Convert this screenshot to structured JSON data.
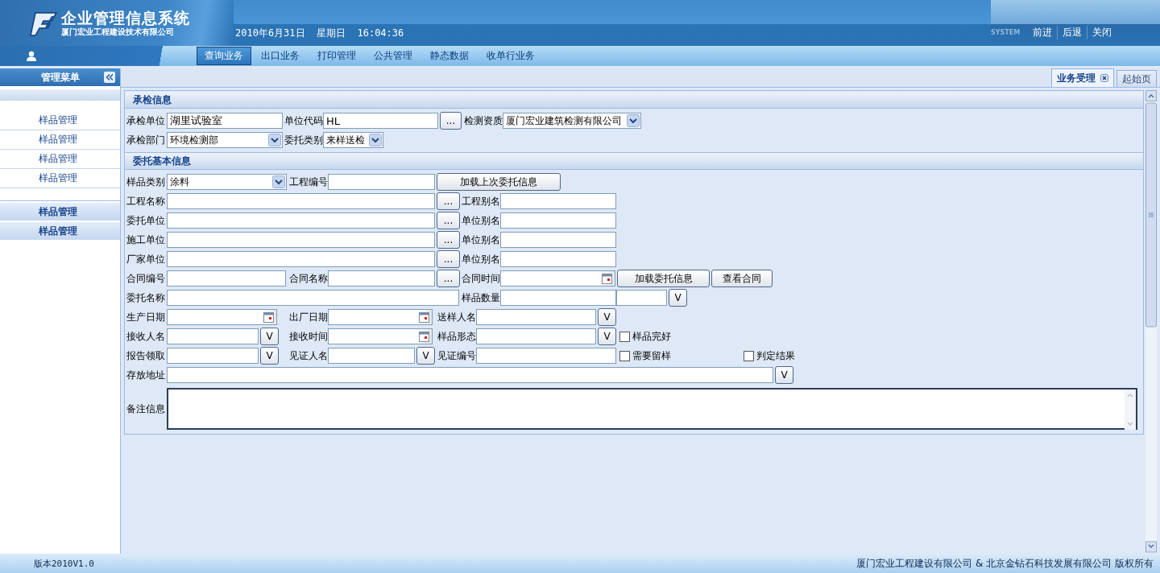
{
  "header": {
    "title": "企业管理信息系统",
    "company": "厦门宏业工程建设技术有限公司",
    "datetime": "2010年6月31日  星期日  16:04:36",
    "banner_text": "SYSTEM",
    "links": [
      "前进",
      "后退",
      "关闭"
    ]
  },
  "nav": [
    {
      "label": "查询业务",
      "selected": true
    },
    {
      "label": "出口业务",
      "selected": false
    },
    {
      "label": "打印管理",
      "selected": false
    },
    {
      "label": "公共管理",
      "selected": false
    },
    {
      "label": "静态数据",
      "selected": false
    },
    {
      "label": "收单行业务",
      "selected": false
    }
  ],
  "sidebar": {
    "title": "管理菜单",
    "items": [
      "样品管理",
      "样品管理",
      "样品管理",
      "样品管理"
    ],
    "groups": [
      "样品管理",
      "样品管理"
    ]
  },
  "page_tabs": [
    {
      "label": "业务受理",
      "selected": true,
      "closable": true
    },
    {
      "label": "起始页",
      "selected": false,
      "closable": false
    }
  ],
  "sections": [
    {
      "title": "承检信息",
      "lines": [
        {
          "fields": [
            {
              "kind": "label",
              "text": "承检单位"
            },
            {
              "kind": "text",
              "value": "湖里试验室"
            },
            {
              "kind": "label",
              "text": "单位代码"
            },
            {
              "kind": "text",
              "value": "HL"
            },
            {
              "kind": "button",
              "text": "..."
            },
            {
              "kind": "label",
              "text": "检测资质"
            },
            {
              "kind": "select",
              "value": "厦门宏业建筑检测有限公司"
            }
          ]
        },
        {
          "fields": [
            {
              "kind": "label",
              "text": "承检部门"
            },
            {
              "kind": "select",
              "value": "环境检测部"
            },
            {
              "kind": "label",
              "text": "委托类别"
            },
            {
              "kind": "select",
              "value": "来样送检"
            }
          ]
        }
      ]
    },
    {
      "title": "委托基本信息",
      "lines": [
        {
          "fields": [
            {
              "kind": "label",
              "text": "样品类别"
            },
            {
              "kind": "select",
              "value": "涂料"
            },
            {
              "kind": "label",
              "text": "工程编号"
            },
            {
              "kind": "text"
            },
            {
              "kind": "button",
              "text": "加载上次委托信息"
            }
          ]
        },
        {
          "fields": [
            {
              "kind": "label",
              "text": "工程名称"
            },
            {
              "kind": "text"
            },
            {
              "kind": "button",
              "text": "..."
            },
            {
              "kind": "label",
              "text": "工程别名"
            },
            {
              "kind": "text"
            }
          ]
        },
        {
          "fields": [
            {
              "kind": "label",
              "text": "委托单位"
            },
            {
              "kind": "text"
            },
            {
              "kind": "button",
              "text": "..."
            },
            {
              "kind": "label",
              "text": "单位别名"
            },
            {
              "kind": "text"
            }
          ]
        },
        {
          "fields": [
            {
              "kind": "label",
              "text": "施工单位"
            },
            {
              "kind": "text"
            },
            {
              "kind": "button",
              "text": "..."
            },
            {
              "kind": "label",
              "text": "单位别名"
            },
            {
              "kind": "text"
            }
          ]
        },
        {
          "fields": [
            {
              "kind": "label",
              "text": "厂家单位"
            },
            {
              "kind": "text"
            },
            {
              "kind": "button",
              "text": "..."
            },
            {
              "kind": "label",
              "text": "单位别名"
            },
            {
              "kind": "text"
            }
          ]
        },
        {
          "fields": [
            {
              "kind": "label",
              "text": "合同编号"
            },
            {
              "kind": "text"
            },
            {
              "kind": "label",
              "text": "合同名称"
            },
            {
              "kind": "text"
            },
            {
              "kind": "button",
              "text": "..."
            },
            {
              "kind": "label",
              "text": "合同时间"
            },
            {
              "kind": "date"
            },
            {
              "kind": "button",
              "text": "加载委托信息"
            },
            {
              "kind": "button",
              "text": "查看合同"
            }
          ]
        },
        {
          "fields": [
            {
              "kind": "label",
              "text": "委托名称"
            },
            {
              "kind": "text"
            },
            {
              "kind": "label",
              "text": "样品数量"
            },
            {
              "kind": "text"
            },
            {
              "kind": "text"
            },
            {
              "kind": "button",
              "text": "V"
            }
          ]
        },
        {
          "fields": [
            {
              "kind": "label",
              "text": "生产日期"
            },
            {
              "kind": "date"
            },
            {
              "kind": "label",
              "text": "出厂日期"
            },
            {
              "kind": "date"
            },
            {
              "kind": "label",
              "text": "送样人名"
            },
            {
              "kind": "text"
            },
            {
              "kind": "button",
              "text": "V"
            }
          ]
        },
        {
          "fields": [
            {
              "kind": "label",
              "text": "接收人名"
            },
            {
              "kind": "text"
            },
            {
              "kind": "button",
              "text": "V"
            },
            {
              "kind": "label",
              "text": "接收时间"
            },
            {
              "kind": "date"
            },
            {
              "kind": "label",
              "text": "样品形态"
            },
            {
              "kind": "text"
            },
            {
              "kind": "button",
              "text": "V"
            },
            {
              "kind": "checkbox",
              "text": "样品完好",
              "checked": false
            }
          ]
        },
        {
          "fields": [
            {
              "kind": "label",
              "text": "报告领取"
            },
            {
              "kind": "text"
            },
            {
              "kind": "button",
              "text": "V"
            },
            {
              "kind": "label",
              "text": "见证人名"
            },
            {
              "kind": "text"
            },
            {
              "kind": "button",
              "text": "V"
            },
            {
              "kind": "label",
              "text": "见证编号"
            },
            {
              "kind": "text"
            },
            {
              "kind": "checkbox",
              "text": "需要留样",
              "checked": false
            },
            {
              "kind": "checkbox",
              "text": "判定结果",
              "checked": false
            }
          ]
        },
        {
          "fields": [
            {
              "kind": "label",
              "text": "存放地址"
            },
            {
              "kind": "text"
            },
            {
              "kind": "button",
              "text": "V"
            }
          ]
        },
        {
          "fields": [
            {
              "kind": "label",
              "text": "备注信息"
            },
            {
              "kind": "textarea"
            }
          ]
        }
      ]
    }
  ],
  "footer": {
    "version": "版本2010V1.0",
    "copyright": "厦门宏业工程建设有限公司 & 北京金钻石科技发展有限公司 版权所有"
  }
}
